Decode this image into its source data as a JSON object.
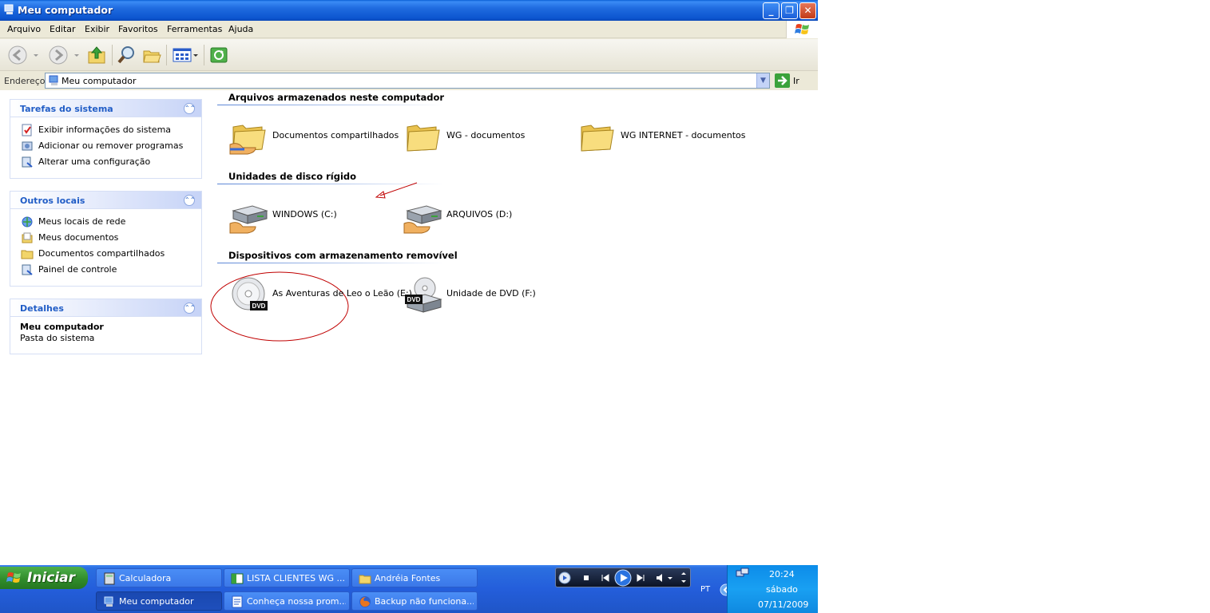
{
  "window": {
    "title": "Meu computador"
  },
  "menu": [
    "Arquivo",
    "Editar",
    "Exibir",
    "Favoritos",
    "Ferramentas",
    "Ajuda"
  ],
  "address": {
    "label": "Endereço",
    "value": "Meu computador",
    "go_label": "Ir"
  },
  "sidebar": {
    "system_tasks": {
      "title": "Tarefas do sistema",
      "items": [
        {
          "label": "Exibir informações do sistema",
          "icon": "system-info-icon"
        },
        {
          "label": "Adicionar ou remover programas",
          "icon": "add-remove-icon"
        },
        {
          "label": "Alterar uma configuração",
          "icon": "control-panel-icon"
        }
      ]
    },
    "other_places": {
      "title": "Outros locais",
      "items": [
        {
          "label": "Meus locais de rede",
          "icon": "network-icon"
        },
        {
          "label": "Meus documentos",
          "icon": "my-documents-icon"
        },
        {
          "label": "Documentos compartilhados",
          "icon": "folder-icon"
        },
        {
          "label": "Painel de controle",
          "icon": "control-panel-icon"
        }
      ]
    },
    "details": {
      "title": "Detalhes",
      "name": "Meu computador",
      "description": "Pasta do sistema"
    }
  },
  "main": {
    "groups": [
      {
        "title": "Arquivos armazenados neste computador",
        "items": [
          {
            "label": "Documentos compartilhados",
            "icon": "shared-folder-icon"
          },
          {
            "label": "WG - documentos",
            "icon": "folder-icon"
          },
          {
            "label": "WG INTERNET - documentos",
            "icon": "folder-icon"
          }
        ]
      },
      {
        "title": "Unidades de disco rígido",
        "items": [
          {
            "label": "WINDOWS (C:)",
            "icon": "hard-drive-shared-icon"
          },
          {
            "label": "ARQUIVOS (D:)",
            "icon": "hard-drive-shared-icon"
          }
        ]
      },
      {
        "title": "Dispositivos com armazenamento removível",
        "items": [
          {
            "label": "As Aventuras de Leo o Leão (E:)",
            "icon": "dvd-disc-icon"
          },
          {
            "label": "Unidade de DVD (F:)",
            "icon": "dvd-drive-icon"
          }
        ]
      }
    ]
  },
  "taskbar": {
    "start_label": "Iniciar",
    "tasks": [
      {
        "label": "Calculadora",
        "icon": "calculator-icon",
        "active": false
      },
      {
        "label": "LISTA CLIENTES WG ...",
        "icon": "spreadsheet-icon",
        "active": false
      },
      {
        "label": "Andréia Fontes",
        "icon": "folder-icon",
        "active": false
      },
      {
        "label": "Meu computador",
        "icon": "my-computer-icon",
        "active": true
      },
      {
        "label": "Conheça nossa prom...",
        "icon": "document-icon",
        "active": false
      },
      {
        "label": "Backup não funciona...",
        "icon": "firefox-icon",
        "active": false
      }
    ],
    "language": "PT",
    "clock": {
      "time": "20:24",
      "day": "sábado",
      "date": "07/11/2009"
    }
  },
  "colors": {
    "titlebar": "#0a5fd6",
    "panel_header_text": "#215dc6",
    "panel_body": "#d6dff7",
    "annotation_red": "#c00000",
    "start_green": "#3c9a36"
  }
}
